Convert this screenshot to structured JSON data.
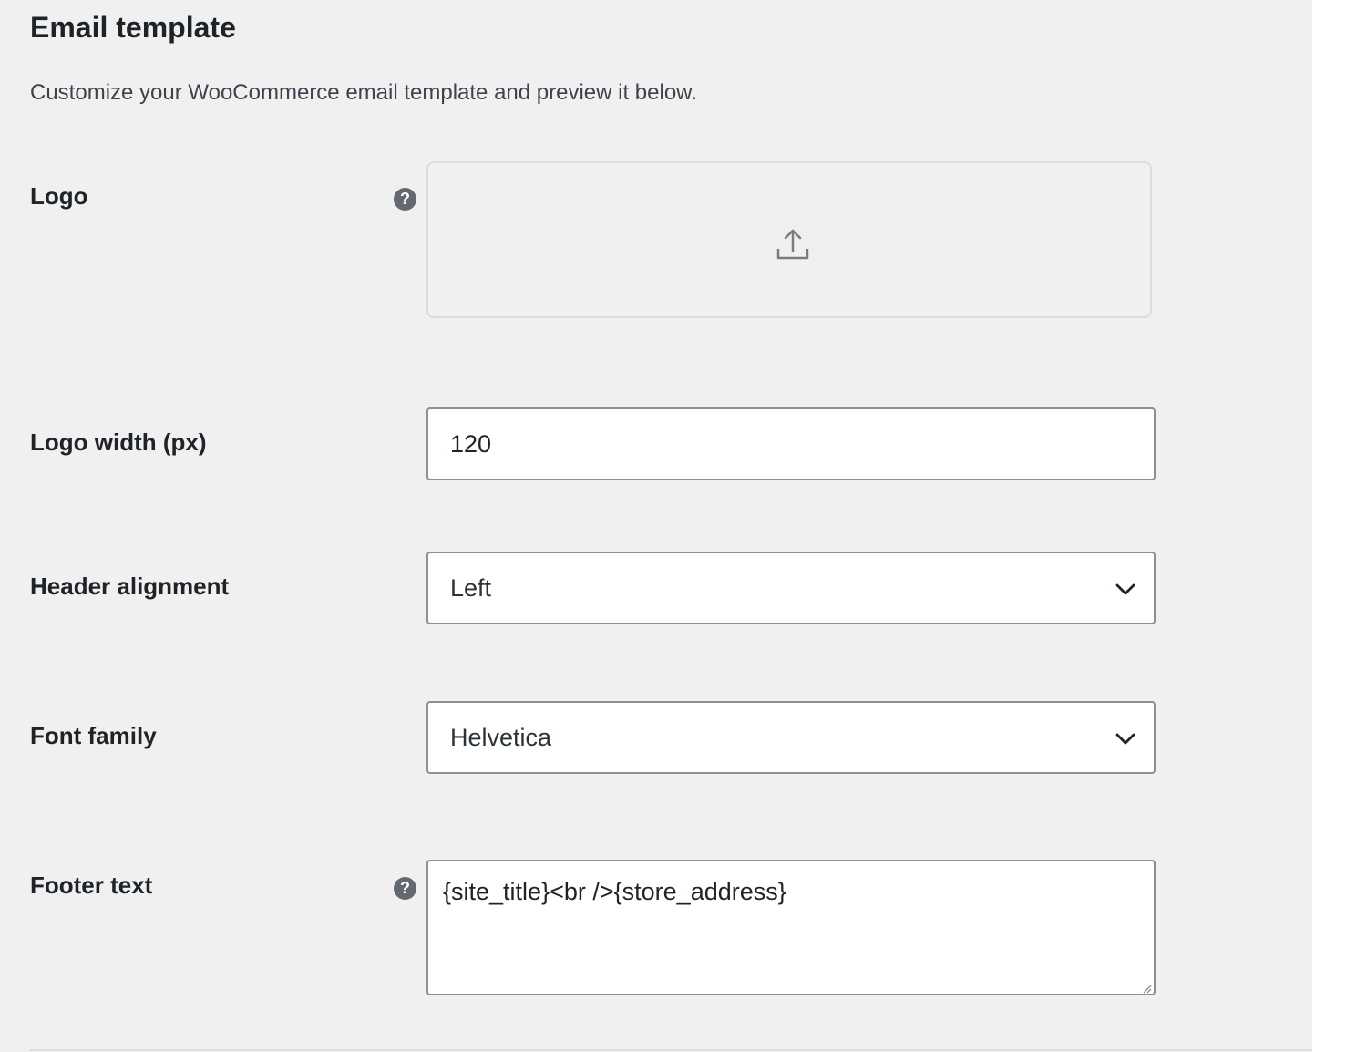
{
  "section": {
    "title": "Email template",
    "description": "Customize your WooCommerce email template and preview it below."
  },
  "fields": {
    "logo": {
      "label": "Logo",
      "help_icon": "question-circle-icon",
      "upload_icon": "upload-icon"
    },
    "logo_width": {
      "label": "Logo width (px)",
      "value": "120"
    },
    "header_alignment": {
      "label": "Header alignment",
      "selected": "Left"
    },
    "font_family": {
      "label": "Font family",
      "selected": "Helvetica"
    },
    "footer_text": {
      "label": "Footer text",
      "value": "{site_title}<br />{store_address}",
      "help_icon": "question-circle-icon"
    }
  },
  "colors": {
    "panel_bg": "#f0f0f1",
    "text": "#1d2327",
    "input_border": "#8c8f94",
    "icon": "#646970"
  }
}
